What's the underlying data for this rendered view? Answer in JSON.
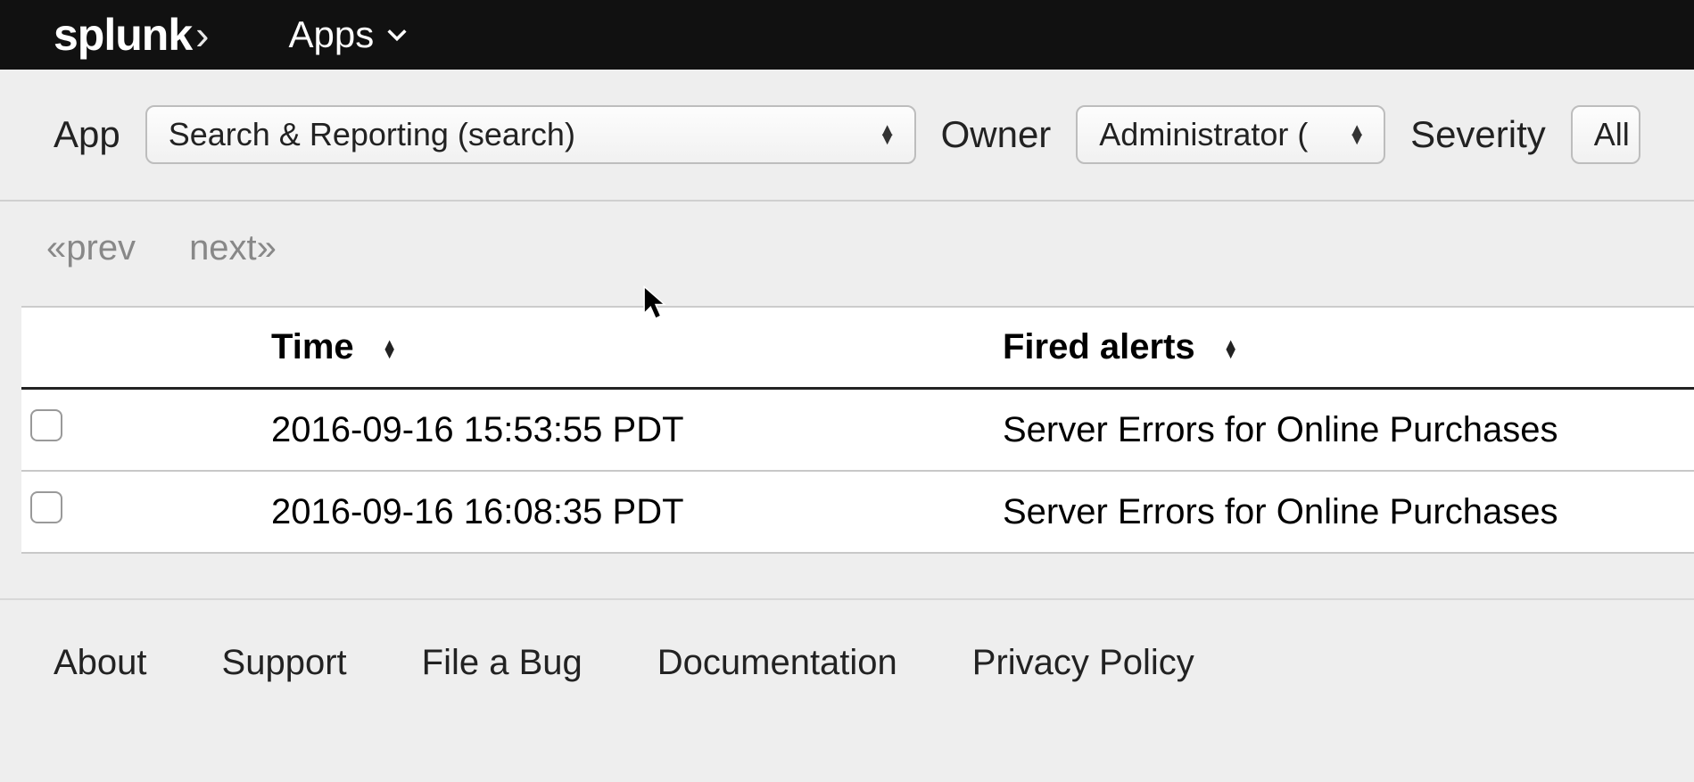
{
  "topbar": {
    "logo_text": "splunk",
    "apps_label": "Apps"
  },
  "filters": {
    "app_label": "App",
    "app_value": "Search & Reporting (search)",
    "owner_label": "Owner",
    "owner_value": "Administrator (",
    "severity_label": "Severity",
    "severity_value": "All"
  },
  "pager": {
    "prev": "«prev",
    "next": "next»"
  },
  "table": {
    "headers": {
      "time": "Time",
      "fired": "Fired alerts"
    },
    "rows": [
      {
        "time": "2016-09-16 15:53:55 PDT",
        "alert": "Server Errors for Online Purchases"
      },
      {
        "time": "2016-09-16 16:08:35 PDT",
        "alert": "Server Errors for Online Purchases"
      }
    ]
  },
  "footer": {
    "about": "About",
    "support": "Support",
    "bug": "File a Bug",
    "docs": "Documentation",
    "privacy": "Privacy Policy"
  }
}
